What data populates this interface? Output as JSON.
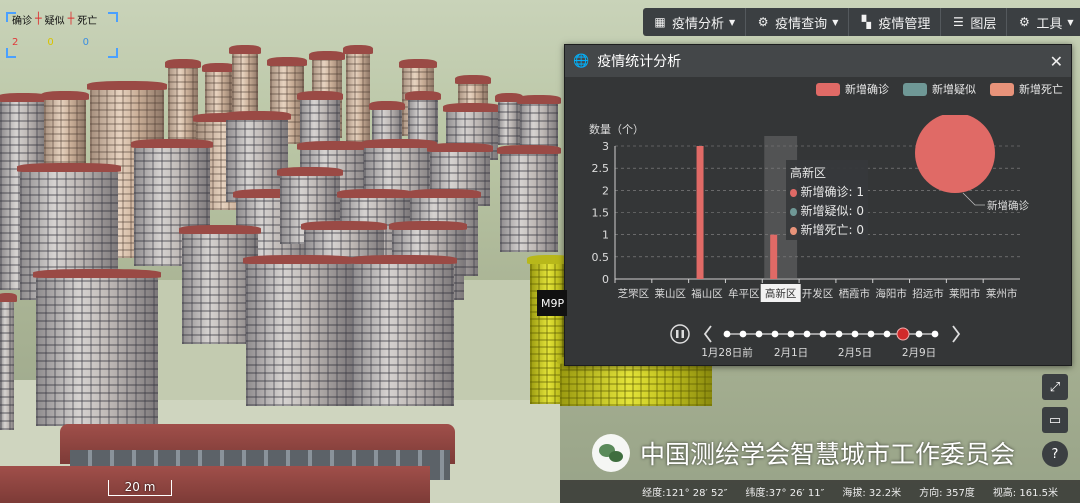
{
  "top_legend": {
    "labels": [
      "确诊",
      "疑似",
      "死亡"
    ],
    "values": [
      "2",
      "0",
      "0"
    ],
    "value_colors": [
      "#e03a3a",
      "#d8c400",
      "#3a8ee0"
    ]
  },
  "toolbar": {
    "items": [
      {
        "label": "疫情分析",
        "icon": "table-icon",
        "has_caret": true
      },
      {
        "label": "疫情查询",
        "icon": "cogs-icon",
        "has_caret": true
      },
      {
        "label": "疫情管理",
        "icon": "map-icon",
        "has_caret": false
      },
      {
        "label": "图层",
        "icon": "list-icon",
        "has_caret": false
      },
      {
        "label": "工具",
        "icon": "cogs-icon",
        "has_caret": true
      }
    ]
  },
  "panel": {
    "title": "疫情统计分析",
    "legend": [
      {
        "name": "新增确诊",
        "color": "#e06a66"
      },
      {
        "name": "新增疑似",
        "color": "#6f9896"
      },
      {
        "name": "新增死亡",
        "color": "#e8937a"
      }
    ]
  },
  "chart_data": [
    {
      "type": "bar",
      "ylabel": "数量（个）",
      "ylim": [
        0,
        3
      ],
      "yticks": [
        "0",
        "0.5",
        "1",
        "1.5",
        "2",
        "2.5",
        "3"
      ],
      "categories": [
        "芝罘区",
        "莱山区",
        "福山区",
        "牟平区",
        "高新区",
        "开发区",
        "栖霞市",
        "海阳市",
        "招远市",
        "莱阳市",
        "莱州市"
      ],
      "series": [
        {
          "name": "新增确诊",
          "values": [
            0,
            0,
            3,
            0,
            1,
            0,
            0,
            0,
            0,
            0,
            0
          ],
          "color": "#e06a66"
        },
        {
          "name": "新增疑似",
          "values": [
            0,
            0,
            0,
            0,
            0,
            0,
            0,
            0,
            0,
            0,
            0
          ],
          "color": "#6f9896"
        },
        {
          "name": "新增死亡",
          "values": [
            0,
            0,
            0,
            0,
            0,
            0,
            0,
            0,
            0,
            0,
            0
          ],
          "color": "#e8937a"
        }
      ],
      "highlighted_category": "高新区",
      "grid": true
    },
    {
      "type": "pie",
      "slices": [
        {
          "name": "新增确诊",
          "value": 2,
          "color": "#e06a66"
        },
        {
          "name": "新增疑似",
          "value": 0,
          "color": "#6f9896"
        },
        {
          "name": "新增死亡",
          "value": 0,
          "color": "#e8937a"
        }
      ],
      "labels": [
        "新增疑似",
        "新增死亡",
        "新增确诊"
      ]
    }
  ],
  "tooltip": {
    "title": "高新区",
    "rows": [
      {
        "label": "新增确诊: 1",
        "color": "#e06a66"
      },
      {
        "label": "新增疑似: 0",
        "color": "#6f9896"
      },
      {
        "label": "新增死亡: 0",
        "color": "#e8937a"
      }
    ]
  },
  "timeline": {
    "labels": [
      "1月28日前",
      "2月1日",
      "2月5日",
      "2月9日"
    ],
    "dot_count": 14,
    "active_index": 11,
    "active_color": "#d12a2a"
  },
  "map_label": "M9P",
  "watermark": "中国测绘学会智慧城市工作委员会",
  "scale": "20 m",
  "status": {
    "longitude": "经度:121° 28′ 52″",
    "latitude": "纬度:37° 26′ 11″",
    "altitude": "海拔: 32.2米",
    "heading": "方向: 357度",
    "view_height": "视高: 161.5米"
  }
}
